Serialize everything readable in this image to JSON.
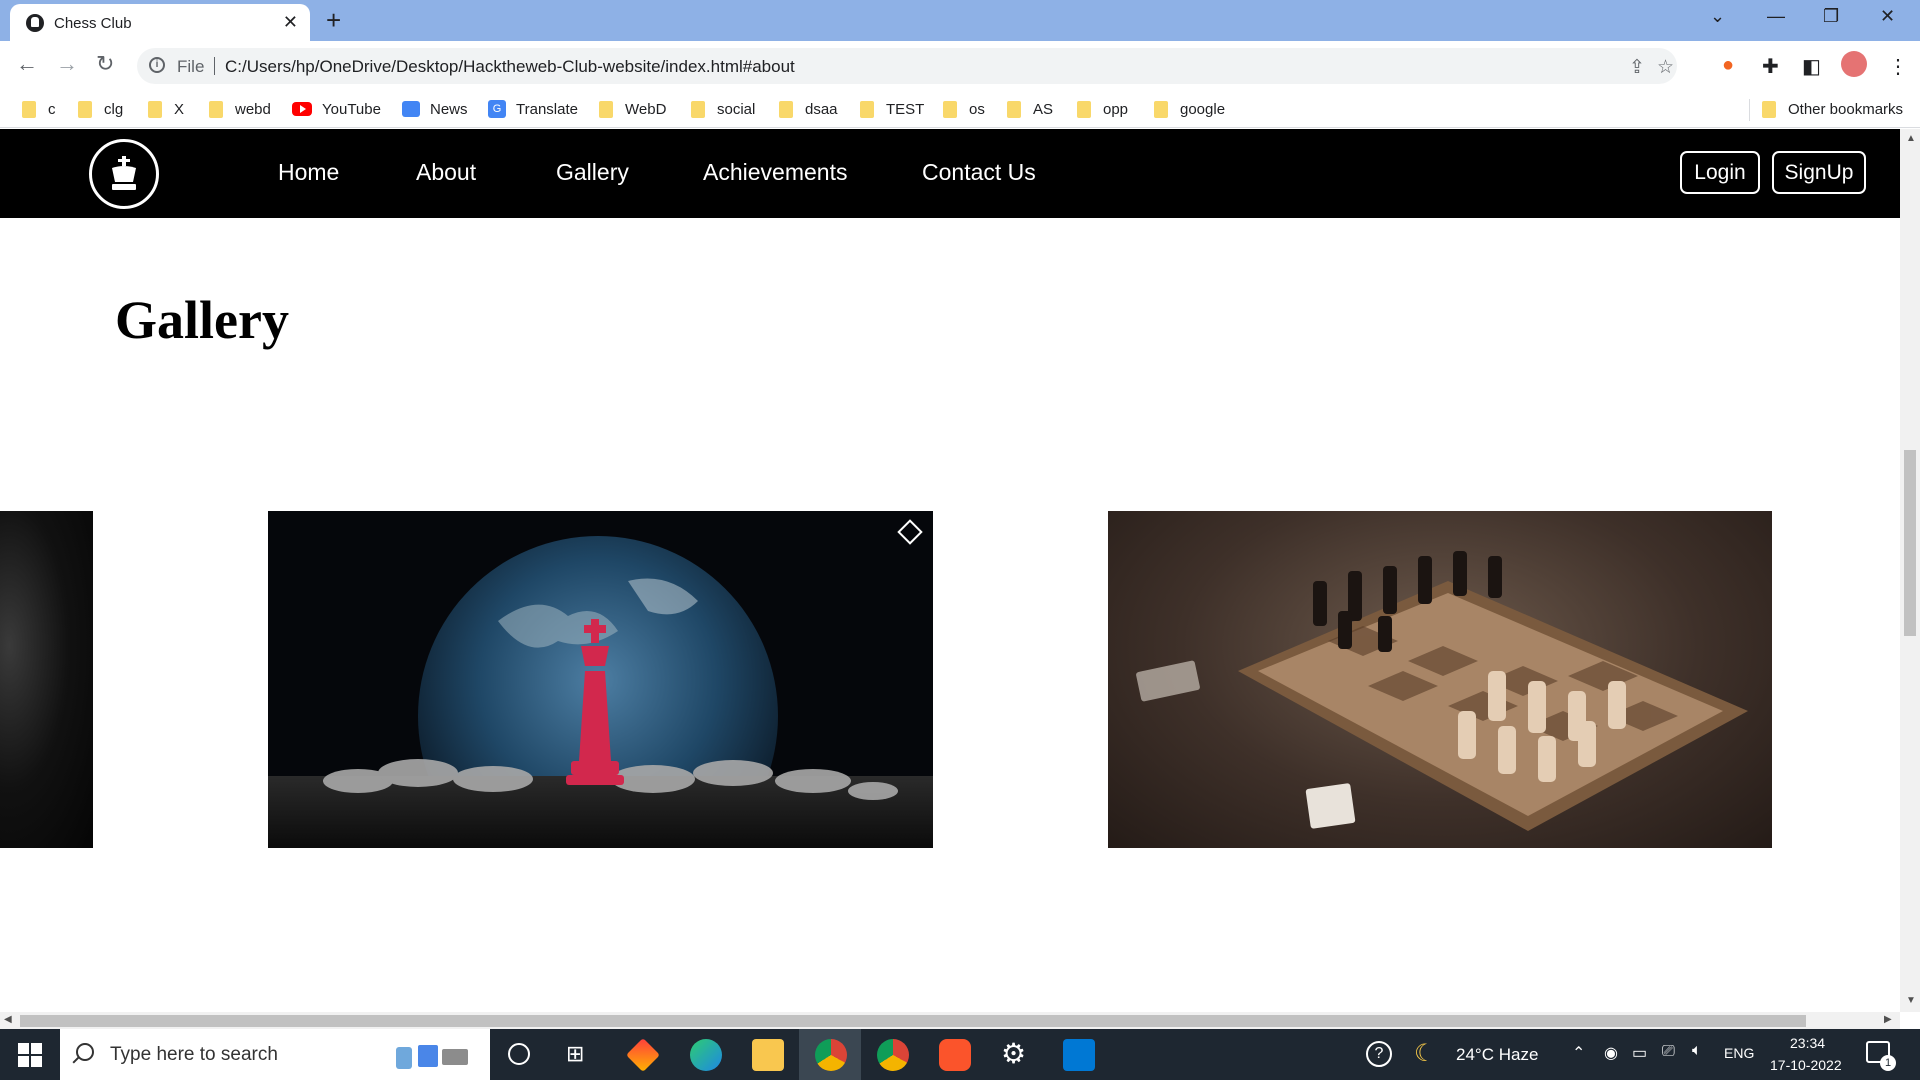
{
  "browser": {
    "tab_title": "Chess Club",
    "file_label": "File",
    "url": "C:/Users/hp/OneDrive/Desktop/Hacktheweb-Club-website/index.html#about",
    "bookmarks": [
      "c",
      "clg",
      "X",
      "webd",
      "YouTube",
      "News",
      "Translate",
      "WebD",
      "social",
      "dsaa",
      "TEST",
      "os",
      "AS",
      "opp",
      "google"
    ],
    "other_bookmarks": "Other bookmarks"
  },
  "site": {
    "nav": [
      "Home",
      "About",
      "Gallery",
      "Achievements",
      "Contact Us"
    ],
    "login": "Login",
    "signup": "SignUp",
    "gallery_heading": "Gallery"
  },
  "taskbar": {
    "search_placeholder": "Type here to search",
    "weather": "24°C  Haze",
    "language": "ENG",
    "time": "23:34",
    "date": "17-10-2022",
    "notifications": "1"
  },
  "colors": {
    "chrome_frame": "#8eb1e6",
    "site_nav_bg": "#000000",
    "taskbar_bg": "#1e2731"
  }
}
